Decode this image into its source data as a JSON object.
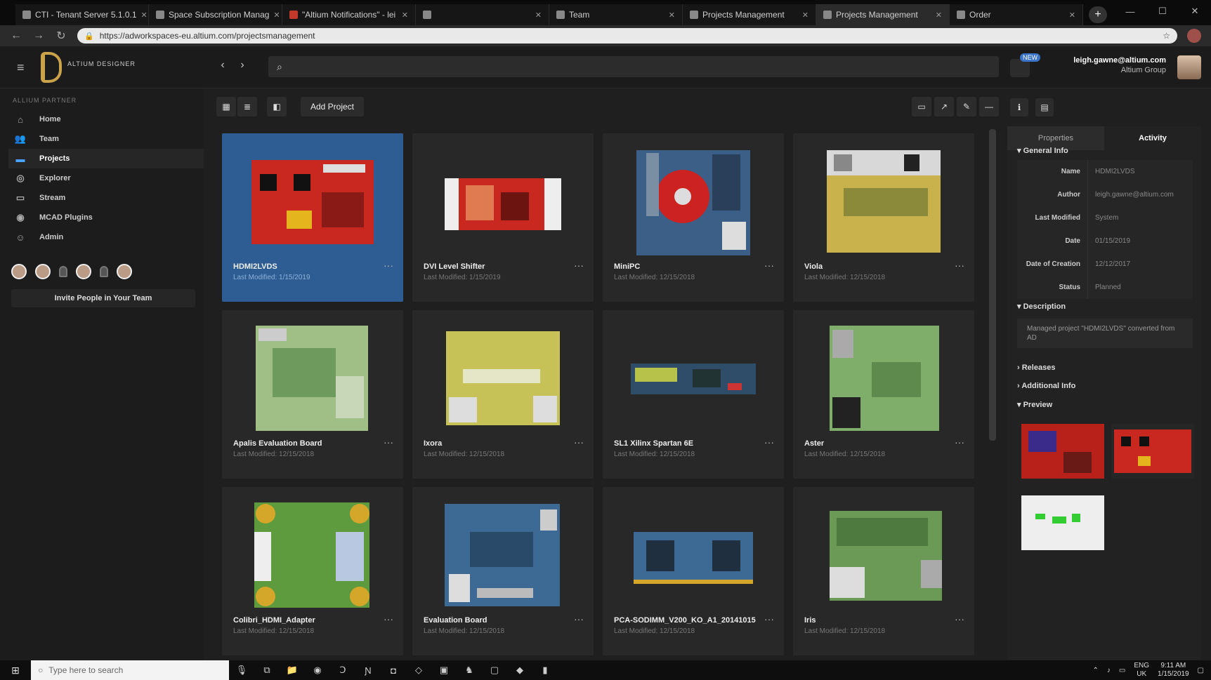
{
  "browser": {
    "tabs": [
      {
        "label": "CTI - Tenant Server 5.1.0.1"
      },
      {
        "label": "Space Subscription Manag"
      },
      {
        "label": "\"Altium Notifications\" - lei"
      },
      {
        "label": ""
      },
      {
        "label": "Team"
      },
      {
        "label": "Projects Management"
      },
      {
        "label": "Projects Management"
      },
      {
        "label": "Order"
      }
    ],
    "url": "https://adworkspaces-eu.altium.com/projectsmanagement"
  },
  "app": {
    "logo_text": "ALTIUM DESIGNER",
    "user_email": "leigh.gawne@altium.com",
    "user_org": "Altium Group",
    "notif_badge": "NEW"
  },
  "sidebar": {
    "workspace_label": "ALLIUM PARTNER",
    "items": [
      {
        "label": "Home",
        "icon": "home-icon"
      },
      {
        "label": "Team",
        "icon": "team-icon"
      },
      {
        "label": "Projects",
        "icon": "folder-icon"
      },
      {
        "label": "Explorer",
        "icon": "explorer-icon"
      },
      {
        "label": "Stream",
        "icon": "stream-icon"
      },
      {
        "label": "MCAD Plugins",
        "icon": "plugin-icon"
      },
      {
        "label": "Admin",
        "icon": "admin-icon"
      }
    ],
    "invite_label": "Invite People in Your Team"
  },
  "toolbar": {
    "add_project": "Add Project"
  },
  "projects": [
    {
      "name": "HDMI2LVDS",
      "modified": "Last Modified: 1/15/2019"
    },
    {
      "name": "DVI Level Shifter",
      "modified": "Last Modified: 1/15/2019"
    },
    {
      "name": "MiniPC",
      "modified": "Last Modified: 12/15/2018"
    },
    {
      "name": "Viola",
      "modified": "Last Modified: 12/15/2018"
    },
    {
      "name": "Apalis Evaluation Board",
      "modified": "Last Modified: 12/15/2018"
    },
    {
      "name": "Ixora",
      "modified": "Last Modified: 12/15/2018"
    },
    {
      "name": "SL1 Xilinx Spartan 6E",
      "modified": "Last Modified: 12/15/2018"
    },
    {
      "name": "Aster",
      "modified": "Last Modified: 12/15/2018"
    },
    {
      "name": "Colibri_HDMI_Adapter",
      "modified": "Last Modified: 12/15/2018"
    },
    {
      "name": "Evaluation Board",
      "modified": "Last Modified: 12/15/2018"
    },
    {
      "name": "PCA-SODIMM_V200_KO_A1_20141015",
      "modified": "Last Modified: 12/15/2018"
    },
    {
      "name": "Iris",
      "modified": "Last Modified: 12/15/2018"
    }
  ],
  "panel": {
    "tabs": [
      "Properties",
      "Activity"
    ],
    "general_info": "General Info",
    "fields": [
      {
        "k": "Name",
        "v": "HDMI2LVDS"
      },
      {
        "k": "Author",
        "v": "leigh.gawne@altium.com"
      },
      {
        "k": "Last Modified",
        "v": "System"
      },
      {
        "k": "Date",
        "v": "01/15/2019"
      },
      {
        "k": "Date of Creation",
        "v": "12/12/2017"
      },
      {
        "k": "Status",
        "v": "Planned"
      }
    ],
    "description_title": "Description",
    "description": "Managed project \"HDMI2LVDS\" converted from AD",
    "releases": "Releases",
    "additional_info": "Additional Info",
    "preview": "Preview"
  },
  "taskbar": {
    "search_placeholder": "Type here to search",
    "lang": "ENG",
    "region": "UK",
    "time": "9:11 AM",
    "date": "1/15/2019"
  }
}
